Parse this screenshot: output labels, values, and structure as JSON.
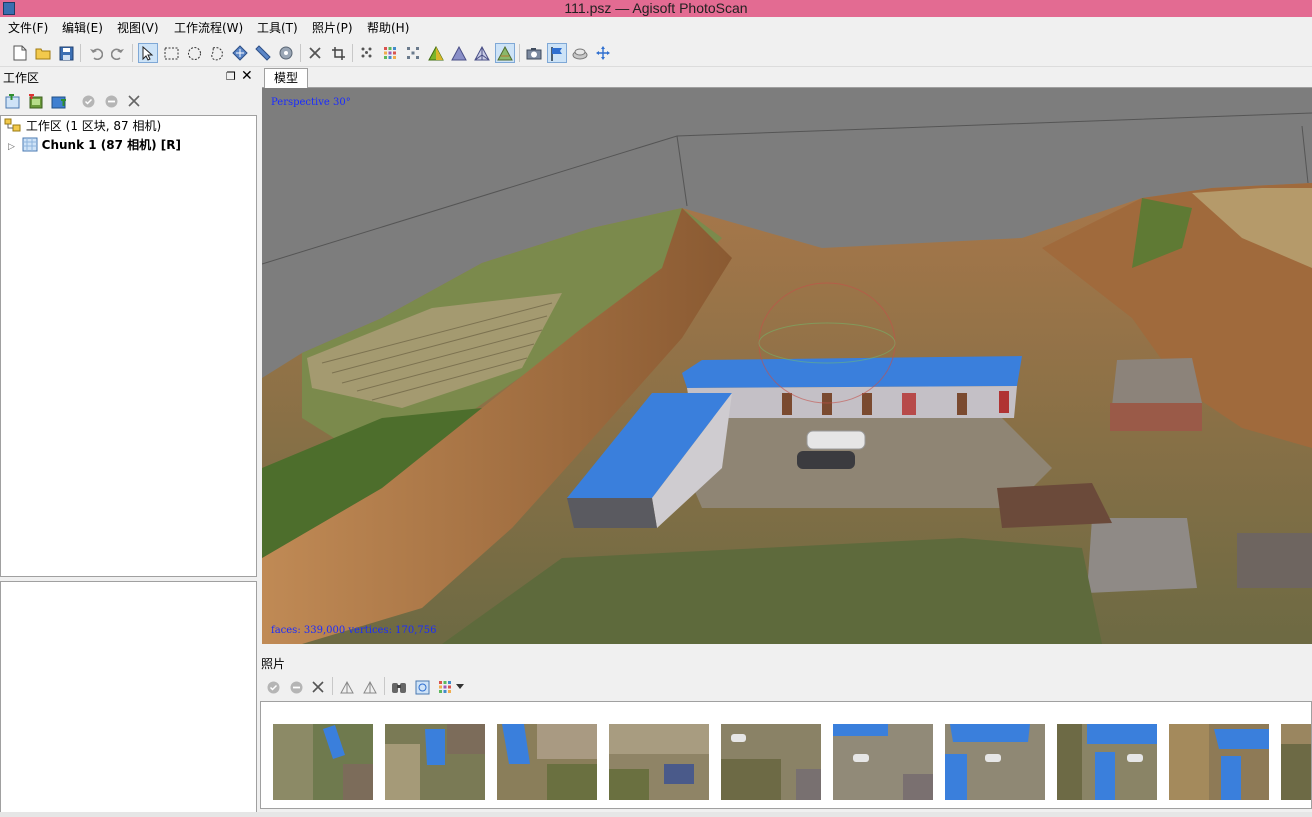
{
  "window": {
    "title": "111.psz — Agisoft PhotoScan"
  },
  "menu": [
    {
      "label": "文件(F)"
    },
    {
      "label": "编辑(E)"
    },
    {
      "label": "视图(V)"
    },
    {
      "label": "工作流程(W)"
    },
    {
      "label": "工具(T)"
    },
    {
      "label": "照片(P)"
    },
    {
      "label": "帮助(H)"
    }
  ],
  "toolbar": {
    "icons": [
      "new-icon",
      "open-icon",
      "save-icon",
      "undo-icon",
      "redo-icon",
      "select-icon",
      "rect-select-icon",
      "circle-select-icon",
      "free-select-icon",
      "move-region-icon",
      "resize-region-icon",
      "rotate-region-icon",
      "delete-icon",
      "crop-icon",
      "point-cloud-icon",
      "dense-cloud-icon",
      "dense-color-icon",
      "shaded-model-icon",
      "solid-model-icon",
      "wireframe-model-icon",
      "textured-model-icon",
      "cameras-icon",
      "markers-icon",
      "region-icon",
      "navigation-icon"
    ],
    "active": [
      "select-icon",
      "textured-model-icon",
      "markers-icon"
    ]
  },
  "workspace": {
    "title": "工作区",
    "tree": {
      "root_label": "工作区 (1 区块, 87 相机)",
      "chunk_label": "Chunk 1 (87 相机) [R]"
    }
  },
  "model": {
    "tab_label": "模型",
    "projection_label": "Perspective 30°",
    "stats_label": "faces: 339,000 vertices: 170,756"
  },
  "photos": {
    "title": "照片",
    "thumb_count": 10
  },
  "colors": {
    "titlebar": "#e36b92",
    "viewport_bg": "#7d7d7d",
    "overlay_text": "#1a2cff",
    "roof_blue": "#3a7fdc"
  }
}
